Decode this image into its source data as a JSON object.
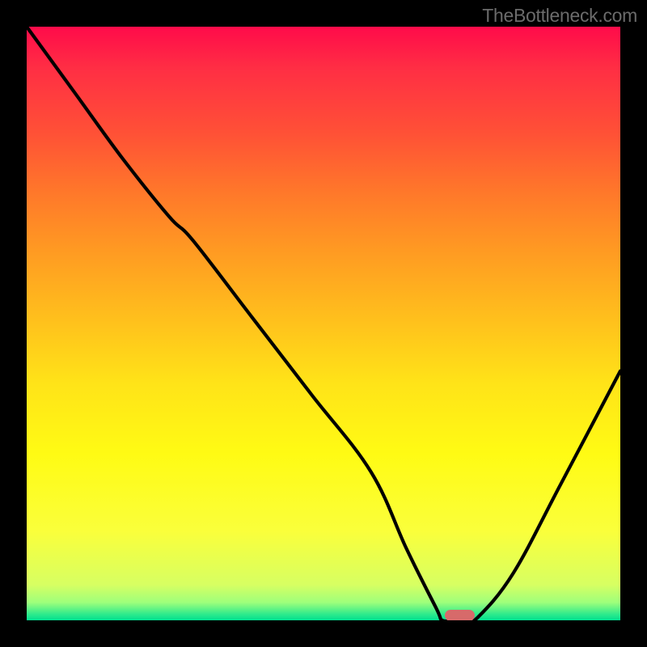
{
  "attribution": "TheBottleneck.com",
  "colors": {
    "background": "#000000",
    "pill": "#d76a6a",
    "curve": "#000000",
    "gradient_stops": [
      "#ff0b4a",
      "#ff2e44",
      "#ff5136",
      "#ff782a",
      "#ff9b22",
      "#ffc21c",
      "#ffe318",
      "#fffb14",
      "#faff3b",
      "#d7ff62",
      "#9eff7b",
      "#2dea8c",
      "#00e08f"
    ]
  },
  "chart_data": {
    "type": "line",
    "title": "",
    "xlabel": "",
    "ylabel": "",
    "xlim": [
      0,
      100
    ],
    "ylim": [
      0,
      100
    ],
    "note": "Background vertical heat gradient red→green; single black curve; red-pink pill marker near minimum.",
    "series": [
      {
        "name": "bottleneck-curve",
        "x": [
          0,
          8,
          16,
          24,
          28,
          38,
          48,
          58,
          64,
          69,
          70,
          72,
          74,
          76,
          82,
          90,
          100
        ],
        "values": [
          100,
          89,
          78,
          68,
          64,
          51,
          38,
          25,
          12,
          2,
          0,
          0,
          0,
          0.5,
          8,
          23,
          42
        ]
      }
    ],
    "marker": {
      "name": "optimal-point-pill",
      "x_center": 73,
      "y_center": 0.8,
      "width_pct": 5.0,
      "height_pct": 2.0
    }
  }
}
